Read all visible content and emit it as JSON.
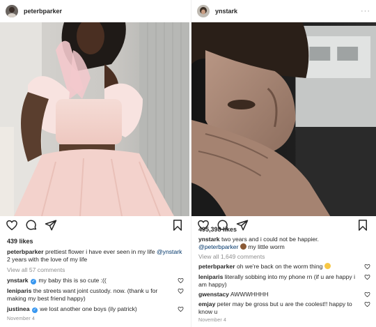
{
  "left_post": {
    "username": "peterbparker",
    "more_label": "···",
    "likes": "439 likes",
    "caption_user": "peterbparker",
    "caption_text": "prettiest flower i have ever seen in my life",
    "caption_mention": "@ynstark",
    "caption_text2": "2 years with the love of my life",
    "view_all": "View all 57 comments",
    "comments": [
      {
        "user": "ynstark",
        "text": "my baby this is so cute :((",
        "verified": true
      },
      {
        "user": "leniparis",
        "text": "the streets want joint custody. now. (thank u for making my best friend happy)",
        "verified": false
      },
      {
        "user": "justinea",
        "text": "we lost another one boys (ily patrick)",
        "verified": true
      }
    ],
    "date": "November 4"
  },
  "right_post": {
    "username": "ynstark",
    "more_label": "···",
    "likes": "495,398 likes",
    "caption_user": "ynstark",
    "caption_text": "two years and i could not be happier.",
    "caption_mention": "@peterbparker",
    "caption_text2": "my little worm",
    "view_all": "View all 1,649 comments",
    "comments": [
      {
        "user": "peterbparker",
        "text": "oh we're back on the worm thing"
      },
      {
        "user": "leniparis",
        "text": "literally sobbing into my phone rn (if u are happy i am happy)"
      },
      {
        "user": "gwenstacy",
        "text": "AWWWHHHH"
      },
      {
        "user": "emjay",
        "text": "peter may be gross but u are the coolest!! happy to know u"
      }
    ],
    "date": "November 4"
  },
  "icons": {
    "like": "heart-icon",
    "comment": "comment-bubble-icon",
    "share": "paper-plane-icon",
    "save": "bookmark-icon"
  },
  "colors": {
    "link": "#003569",
    "verified": "#3897f0",
    "muted": "#8e8e8e",
    "text": "#262626"
  }
}
